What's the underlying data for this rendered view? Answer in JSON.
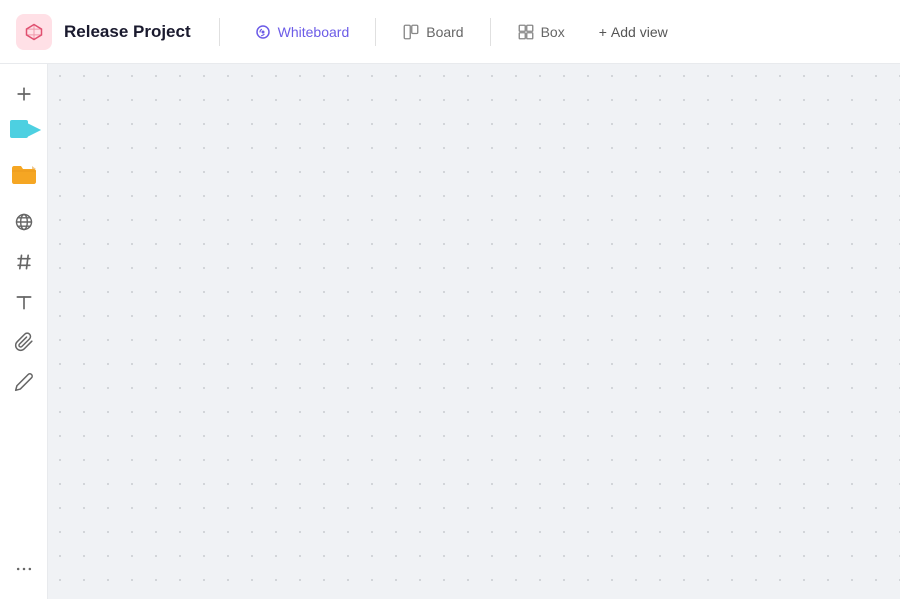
{
  "header": {
    "project_title": "Release Project",
    "tabs": [
      {
        "id": "whiteboard",
        "label": "Whiteboard",
        "active": true,
        "icon": "whiteboard-icon"
      },
      {
        "id": "board",
        "label": "Board",
        "active": false,
        "icon": "board-icon"
      },
      {
        "id": "box",
        "label": "Box",
        "active": false,
        "icon": "box-icon"
      }
    ],
    "add_view_label": "Add view",
    "add_view_prefix": "+"
  },
  "sidebar": {
    "items": [
      {
        "id": "plus",
        "icon": "plus-icon",
        "label": "Add"
      },
      {
        "id": "sticky",
        "icon": "sticky-notes-icon",
        "label": "Sticky Notes"
      },
      {
        "id": "folder",
        "icon": "folder-icon",
        "label": "Folder"
      },
      {
        "id": "globe",
        "icon": "globe-icon",
        "label": "Globe"
      },
      {
        "id": "hashtag",
        "icon": "hashtag-icon",
        "label": "Hashtag"
      },
      {
        "id": "text",
        "icon": "text-icon",
        "label": "Text"
      },
      {
        "id": "attach",
        "icon": "attach-icon",
        "label": "Attach"
      },
      {
        "id": "draw",
        "icon": "draw-icon",
        "label": "Draw"
      },
      {
        "id": "more",
        "icon": "more-icon",
        "label": "More"
      }
    ]
  },
  "canvas": {
    "background_color": "#f0f2f5",
    "dot_color": "#c8cbd0"
  },
  "colors": {
    "active_tab": "#6c5ce7",
    "header_bg": "#ffffff",
    "sidebar_bg": "#ffffff",
    "canvas_bg": "#f0f2f5",
    "sticky_cyan": "#4dd0e1",
    "folder_orange": "#f5a623",
    "project_icon_bg": "#ffe0e6",
    "project_icon_color": "#e05070"
  }
}
